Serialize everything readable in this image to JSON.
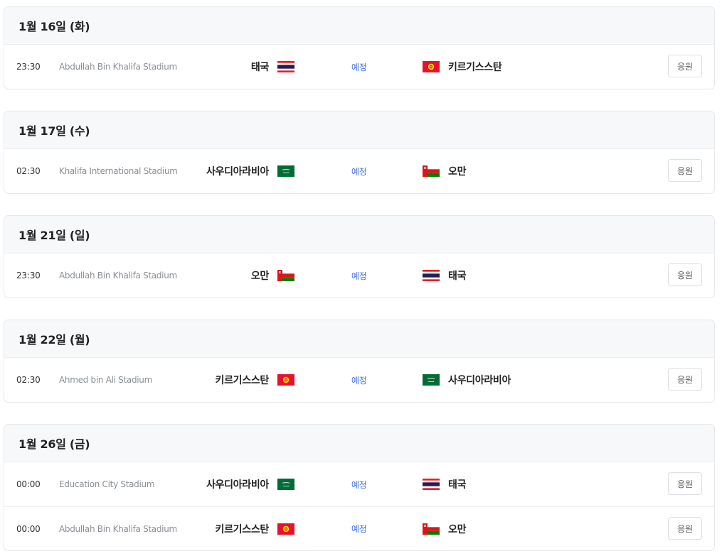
{
  "status_label": "예정",
  "cheer_label": "응원",
  "days": [
    {
      "date": "1월 16일 (화)",
      "matches": [
        {
          "time": "23:30",
          "stadium": "Abdullah Bin Khalifa Stadium",
          "home": "태국",
          "home_flag": "thailand",
          "away": "키르기스스탄",
          "away_flag": "kyrgyzstan"
        }
      ]
    },
    {
      "date": "1월 17일 (수)",
      "matches": [
        {
          "time": "02:30",
          "stadium": "Khalifa International Stadium",
          "home": "사우디아라비아",
          "home_flag": "saudi-arabia",
          "away": "오만",
          "away_flag": "oman"
        }
      ]
    },
    {
      "date": "1월 21일 (일)",
      "matches": [
        {
          "time": "23:30",
          "stadium": "Abdullah Bin Khalifa Stadium",
          "home": "오만",
          "home_flag": "oman",
          "away": "태국",
          "away_flag": "thailand"
        }
      ]
    },
    {
      "date": "1월 22일 (월)",
      "matches": [
        {
          "time": "02:30",
          "stadium": "Ahmed bin Ali Stadium",
          "home": "키르기스스탄",
          "home_flag": "kyrgyzstan",
          "away": "사우디아라비아",
          "away_flag": "saudi-arabia"
        }
      ]
    },
    {
      "date": "1월 26일 (금)",
      "matches": [
        {
          "time": "00:00",
          "stadium": "Education City Stadium",
          "home": "사우디아라비아",
          "home_flag": "saudi-arabia",
          "away": "태국",
          "away_flag": "thailand"
        },
        {
          "time": "00:00",
          "stadium": "Abdullah Bin Khalifa Stadium",
          "home": "키르기스스탄",
          "home_flag": "kyrgyzstan",
          "away": "오만",
          "away_flag": "oman"
        }
      ]
    }
  ]
}
